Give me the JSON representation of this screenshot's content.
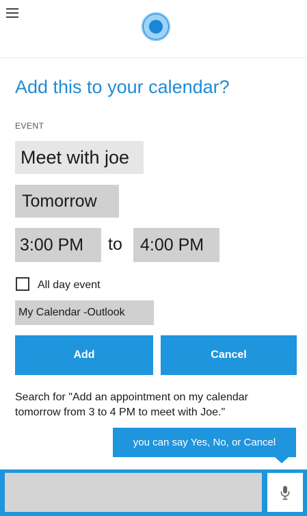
{
  "header": {
    "menu_icon": "hamburger-menu-icon",
    "assistant_icon": "cortana-circle-icon"
  },
  "dialog": {
    "title": "Add this to your calendar?",
    "event_section_label": "EVENT",
    "event_name": "Meet with joe",
    "date": "Tomorrow",
    "start_time": "3:00 PM",
    "to_label": "to",
    "end_time": "4:00 PM",
    "all_day_label": "All day event",
    "all_day_checked": false,
    "calendar": "My Calendar  -Outlook",
    "add_label": "Add",
    "cancel_label": "Cancel"
  },
  "search_suggestion": "Search for \"Add an appointment on my calendar tomorrow from 3 to 4 PM to meet with Joe.\"",
  "speech_bubble": "you can say Yes, No, or Cancel",
  "input_bar": {
    "value": "",
    "mic_icon": "microphone-icon"
  },
  "colors": {
    "accent": "#1f95dd",
    "title": "#1f8bd6",
    "field_bg": "#d0d0d0"
  }
}
